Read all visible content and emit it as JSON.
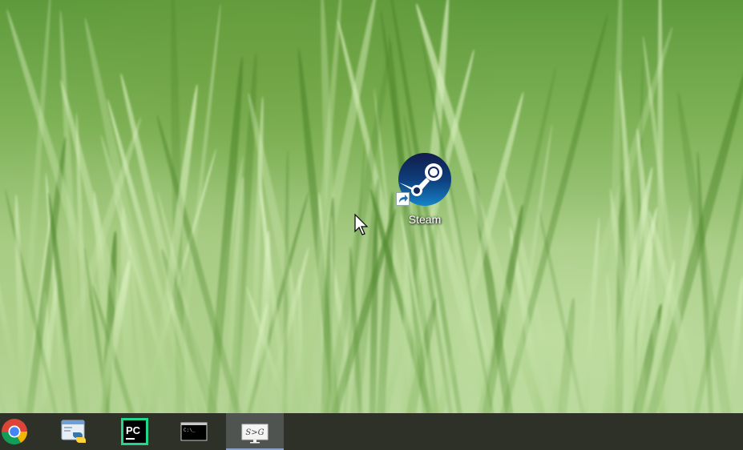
{
  "desktop": {
    "wallpaper": "green grass close-up",
    "icons": [
      {
        "label": "Steam",
        "icon": "steam-icon",
        "shortcut": true
      }
    ]
  },
  "taskbar": {
    "background": "#2d3128",
    "items": [
      {
        "name": "Google Chrome",
        "icon": "chrome-icon",
        "active": false
      },
      {
        "name": "Python IDLE",
        "icon": "python-icon",
        "active": false
      },
      {
        "name": "PyCharm",
        "icon": "pycharm-icon",
        "icon_text": "PC",
        "active": false
      },
      {
        "name": "Command Prompt",
        "icon": "terminal-icon",
        "icon_text": "C:\\_",
        "active": false
      },
      {
        "name": "Active App",
        "icon": "app-icon",
        "icon_text": "S>G",
        "active": true
      }
    ]
  },
  "colors": {
    "steam_dark": "#0f2556",
    "steam_light": "#1a9fff",
    "pycharm_green": "#21d789"
  }
}
